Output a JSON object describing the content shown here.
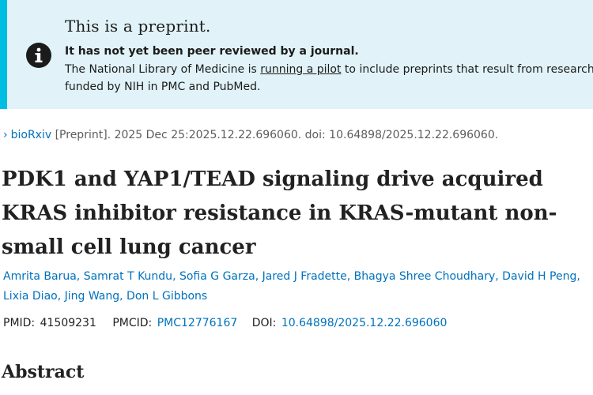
{
  "banner": {
    "title": "This is a preprint.",
    "strong": "It has not yet been peer reviewed by a journal.",
    "body_before": "The National Library of Medicine is ",
    "link": "running a pilot",
    "body_after": " to include preprints that result from research funded by NIH in PMC and PubMed.",
    "icon": "info-icon",
    "accent": "#00bde3",
    "background": "#e1f3f8"
  },
  "citation": {
    "chevron": "›",
    "journal": "bioRxiv",
    "rest": " [Preprint]. 2025 Dec 25:2025.12.22.696060. doi: 10.64898/2025.12.22.696060."
  },
  "article": {
    "title": "PDK1 and YAP1/TEAD signaling drive acquired KRAS inhibitor resistance in KRAS-mutant non-small cell lung cancer"
  },
  "authors": [
    "Amrita Barua",
    "Samrat T Kundu",
    "Sofia G Garza",
    "Jared J Fradette",
    "Bhagya Shree Choudhary",
    "David H Peng",
    "Lixia Diao",
    "Jing Wang",
    "Don L Gibbons"
  ],
  "ids": {
    "pmid_label": "PMID: ",
    "pmid": "41509231",
    "pmcid_label": "PMCID: ",
    "pmcid": "PMC12776167",
    "doi_label": "DOI: ",
    "doi": "10.64898/2025.12.22.696060"
  },
  "abstract": {
    "heading": "Abstract"
  },
  "colors": {
    "link": "#0071bc",
    "text": "#212121"
  }
}
